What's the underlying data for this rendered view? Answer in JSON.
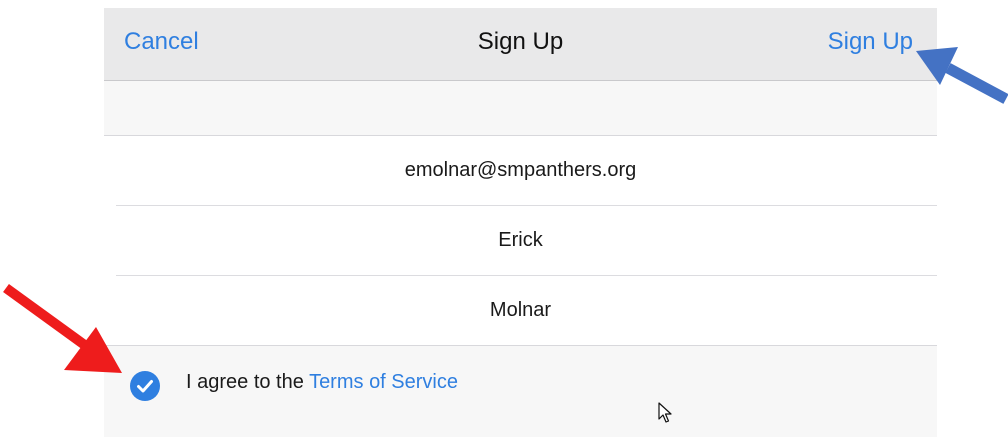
{
  "navbar": {
    "cancel_label": "Cancel",
    "title": "Sign Up",
    "signup_label": "Sign Up"
  },
  "form": {
    "email": "emolnar@smpanthers.org",
    "first_name": "Erick",
    "last_name": "Molnar"
  },
  "agreement": {
    "checked": true,
    "prefix": "I agree to the ",
    "link_label": "Terms of Service"
  },
  "annotations": {
    "red_arrow_color": "#ee1c1c",
    "blue_arrow_color": "#4472c4"
  },
  "colors": {
    "accent": "#2f7fe0",
    "navbar_bg": "#e9e9ea"
  }
}
